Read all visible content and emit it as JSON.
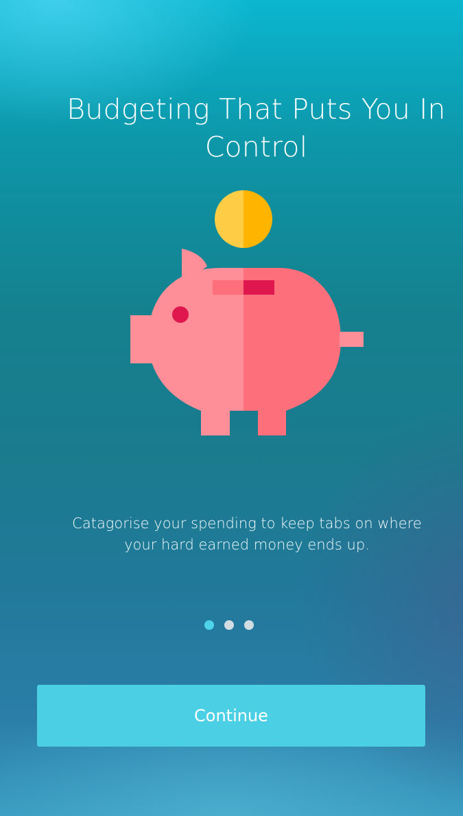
{
  "onboarding": {
    "title": "Budgeting That Puts You In Control",
    "description": "Catagorise your spending to keep tabs on where your hard earned money ends up.",
    "illustration": {
      "icon": "piggy-bank-icon",
      "coin_icon": "coin-icon",
      "colors": {
        "coin_left": "#FFCD45",
        "coin_right": "#FFB400",
        "pig_left": "#FE8E98",
        "pig_right": "#FD6F7B",
        "eye": "#E0174E",
        "slot_left": "#FD6F7B",
        "slot_right": "#E0174E"
      }
    },
    "pager": {
      "total": 3,
      "active_index": 0
    },
    "continue_label": "Continue"
  },
  "theme": {
    "accent": "#4BCFE4",
    "dot_active": "#4FD3EA",
    "dot_inactive": "#D2DDE2"
  }
}
